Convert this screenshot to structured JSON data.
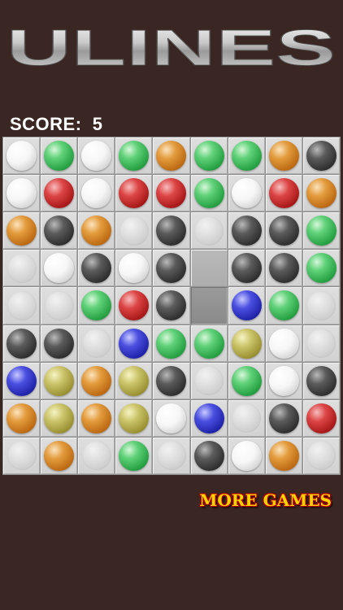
{
  "app_title": "ULINES",
  "score": {
    "label": "SCORE:",
    "value": "5"
  },
  "more_games_label": "MORE GAMES",
  "board": {
    "size": 9,
    "rows": [
      [
        "white",
        "green",
        "white",
        "green",
        "orange",
        "green",
        "green",
        "orange",
        "black"
      ],
      [
        "white",
        "red",
        "white",
        "red",
        "red",
        "green",
        "white",
        "red",
        "orange"
      ],
      [
        "orange",
        "black",
        "orange",
        "empty",
        "black",
        "empty",
        "black",
        "black",
        "green"
      ],
      [
        "empty",
        "white",
        "black",
        "white",
        "black",
        "empty",
        "black",
        "black",
        "green"
      ],
      [
        "empty",
        "empty",
        "green",
        "red",
        "black",
        "empty",
        "blue",
        "green",
        "empty"
      ],
      [
        "black",
        "black",
        "empty",
        "blue",
        "green",
        "green",
        "yellow",
        "white",
        "empty"
      ],
      [
        "blue",
        "yellow",
        "orange",
        "yellow",
        "black",
        "empty",
        "green",
        "white",
        "black"
      ],
      [
        "orange",
        "yellow",
        "orange",
        "yellow",
        "white",
        "blue",
        "empty",
        "black",
        "red"
      ],
      [
        "empty",
        "orange",
        "empty",
        "green",
        "empty",
        "black",
        "white",
        "orange",
        "empty"
      ]
    ],
    "selected_cell": {
      "row": 4,
      "col": 5
    },
    "dimmed_cell": {
      "row": 3,
      "col": 5
    }
  },
  "colors": {
    "background": "#3a2622",
    "board": "#8f8f8f",
    "score_text": "#ffffff",
    "more_games_text": "#ffd400",
    "more_games_outline": "#b30000"
  }
}
